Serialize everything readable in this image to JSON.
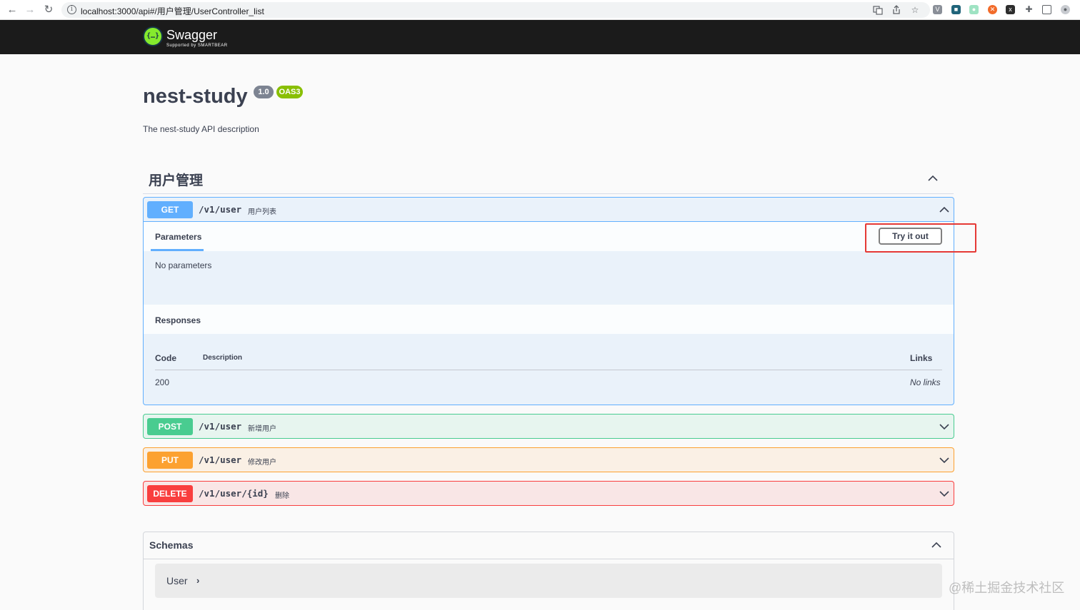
{
  "browser": {
    "url": "localhost:3000/api#/用户管理/UserController_list",
    "back_icon": "←",
    "forward_icon": "→",
    "reload_icon": "↻"
  },
  "topbar": {
    "logo_text": "Swagger",
    "logo_sub": "Supported by SMARTBEAR",
    "logo_mark": "{…}"
  },
  "info": {
    "title": "nest-study",
    "version": "1.0",
    "oas": "OAS3",
    "description": "The nest-study API description"
  },
  "tag": {
    "name": "用户管理"
  },
  "operations": [
    {
      "method": "GET",
      "path": "/v1/user",
      "summary": "用户列表"
    },
    {
      "method": "POST",
      "path": "/v1/user",
      "summary": "新增用户"
    },
    {
      "method": "PUT",
      "path": "/v1/user",
      "summary": "修改用户"
    },
    {
      "method": "DELETE",
      "path": "/v1/user/{id}",
      "summary": "删除"
    }
  ],
  "get_details": {
    "parameters_label": "Parameters",
    "try_button": "Try it out",
    "no_parameters": "No parameters",
    "responses_label": "Responses",
    "col_code": "Code",
    "col_description": "Description",
    "col_links": "Links",
    "response_code": "200",
    "response_links": "No links"
  },
  "schemas": {
    "title": "Schemas",
    "models": [
      "User"
    ],
    "arrow": "›"
  },
  "watermark": "@稀土掘金技术社区",
  "colors": {
    "get": "#61affe",
    "post": "#49cc90",
    "put": "#fca130",
    "delete": "#f93e3e",
    "highlight": "#e53935"
  }
}
